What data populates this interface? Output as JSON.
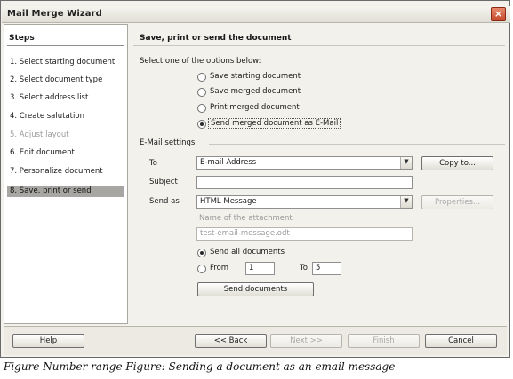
{
  "window": {
    "title": "Mail Merge Wizard",
    "close_glyph": "×"
  },
  "steps": {
    "title": "Steps",
    "items": [
      {
        "label": "1. Select starting document",
        "state": "normal"
      },
      {
        "label": "2. Select document type",
        "state": "normal"
      },
      {
        "label": "3. Select address list",
        "state": "normal"
      },
      {
        "label": "4. Create salutation",
        "state": "normal"
      },
      {
        "label": "5. Adjust layout",
        "state": "disabled"
      },
      {
        "label": "6. Edit document",
        "state": "normal"
      },
      {
        "label": "7. Personalize document",
        "state": "normal"
      },
      {
        "label": "8. Save, print or send",
        "state": "active"
      }
    ]
  },
  "main": {
    "heading": "Save, print or send the document",
    "prompt": "Select one of the options below:",
    "options": [
      {
        "label": "Save starting document",
        "selected": false
      },
      {
        "label": "Save merged document",
        "selected": false
      },
      {
        "label": "Print merged document",
        "selected": false
      },
      {
        "label": "Send merged document as E-Mail",
        "selected": true
      }
    ],
    "email": {
      "section_label": "E-Mail settings",
      "to_label": "To",
      "to_value": "E-mail Address",
      "copy_to_button": "Copy to...",
      "subject_label": "Subject",
      "subject_value": "",
      "send_as_label": "Send as",
      "send_as_value": "HTML Message",
      "properties_button": "Properties...",
      "attachment_label": "Name of the attachment",
      "attachment_value": "test-email-message.odt",
      "send_all_label": "Send all documents",
      "send_all_selected": true,
      "from_label": "From",
      "from_selected": false,
      "from_value": "1",
      "to_range_label": "To",
      "to_range_value": "5",
      "send_documents_button": "Send documents"
    }
  },
  "footer": {
    "help": "Help",
    "back": "<< Back",
    "next": "Next >>",
    "finish": "Finish",
    "cancel": "Cancel"
  },
  "caption": "Figure Number range Figure: Sending a document as an email message"
}
